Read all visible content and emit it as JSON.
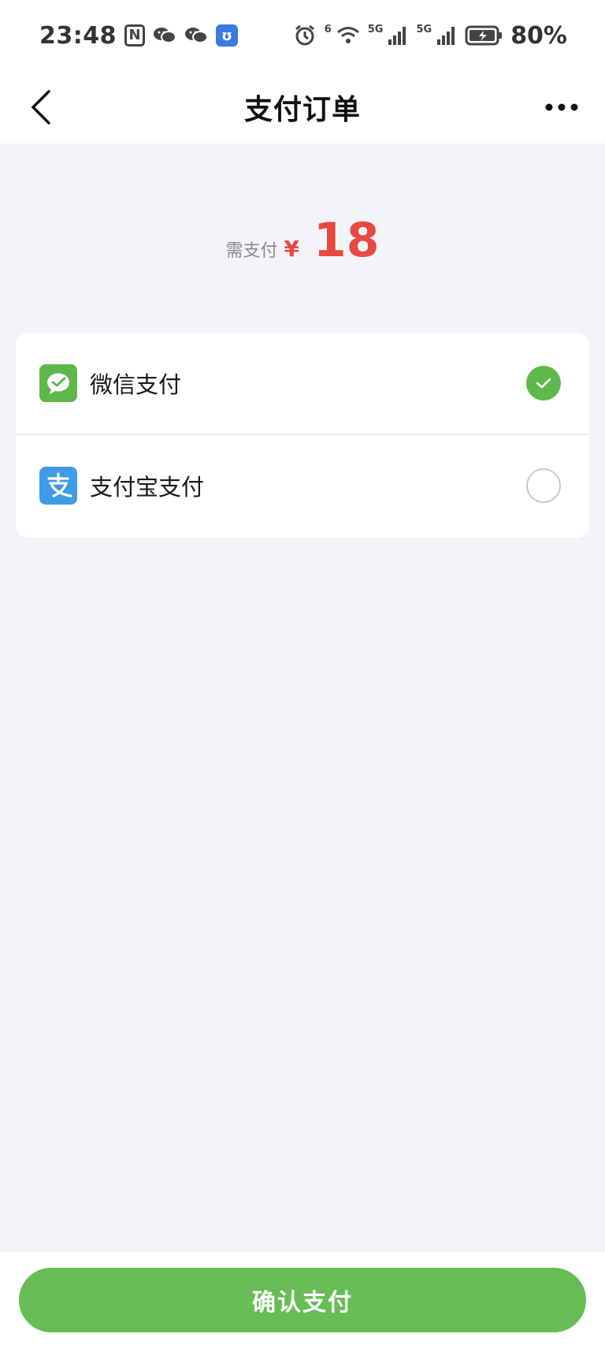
{
  "status_bar": {
    "time": "23:48",
    "battery": "80%",
    "signal_label_1": "5G",
    "signal_label_2": "5G",
    "wifi_label": "6",
    "icons": [
      "nfc-icon",
      "wechat-icon",
      "wechat-icon",
      "app-badge-icon",
      "alarm-icon",
      "wifi-icon",
      "signal-5g-icon",
      "signal-5g-icon",
      "battery-charging-icon"
    ]
  },
  "nav": {
    "title": "支付订单",
    "back_icon": "chevron-left-icon",
    "more_icon": "more-dots-icon"
  },
  "payment": {
    "label": "需支付",
    "currency": "¥",
    "amount": "18"
  },
  "methods": [
    {
      "label": "微信支付",
      "icon": "wechat-pay-icon",
      "selected": true
    },
    {
      "label": "支付宝支付",
      "icon": "alipay-icon",
      "selected": false
    }
  ],
  "footer": {
    "confirm_label": "确认支付"
  },
  "colors": {
    "accent_green": "#66bd54",
    "price_red": "#e8483f",
    "alipay_blue": "#3f9be7",
    "background": "#f3f4f8"
  }
}
